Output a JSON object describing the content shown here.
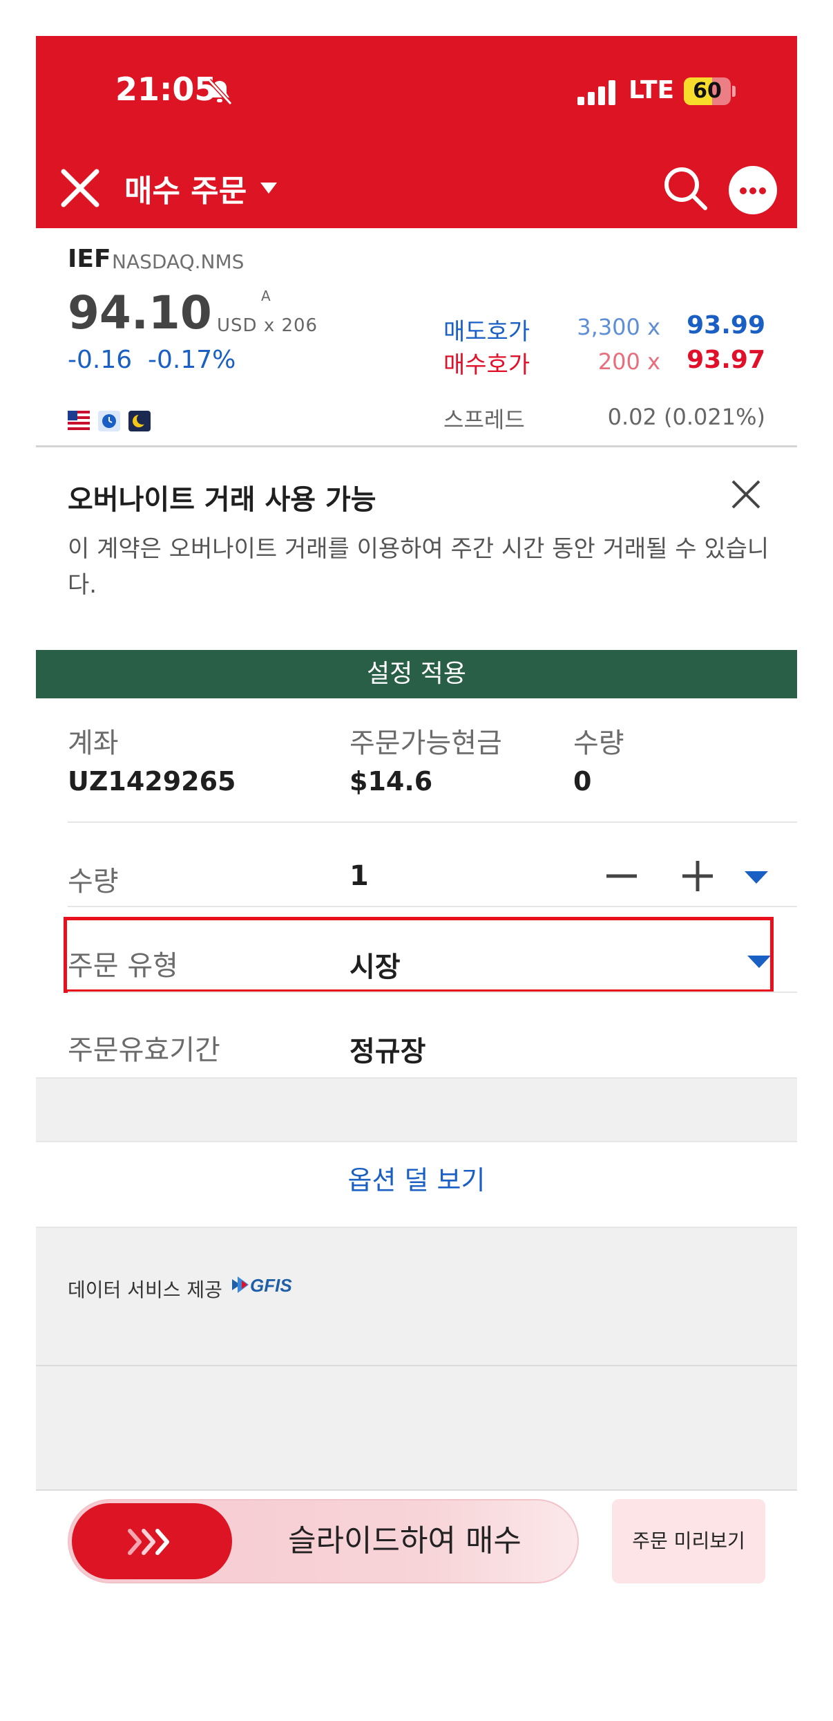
{
  "status_bar": {
    "time": "21:05",
    "network": "LTE",
    "battery": "60",
    "battery_level": 0.6
  },
  "header": {
    "title": "매수 주문",
    "close_icon": "close-icon",
    "search_icon": "search-icon",
    "more_icon": "more-icon"
  },
  "quote": {
    "symbol": "IEF",
    "exchange": "NASDAQ.NMS",
    "last_price": "94.10",
    "flag": "A",
    "currency": "USD x 206",
    "change": "-0.16  -0.17%",
    "ask_label": "매도호가",
    "ask_size": "3,300 x",
    "ask_price": "93.99",
    "bid_label": "매수호가",
    "bid_size": "200 x",
    "bid_price": "93.97",
    "spread_label": "스프레드",
    "spread_value": "0.02 (0.021%)"
  },
  "banner": {
    "title": "오버나이트 거래 사용 가능",
    "text": "이 계약은 오버나이트 거래를 이용하여 주간 시간 동안 거래될 수 있습니다."
  },
  "apply_settings": "설정 적용",
  "account": {
    "account_label": "계좌",
    "account_value": "UZ1429265",
    "cash_label": "주문가능현금",
    "cash_value": "$14.6",
    "qty_label": "수량",
    "qty_value": "0"
  },
  "order": {
    "quantity_label": "수량",
    "quantity_value": "1",
    "type_label": "주문 유형",
    "type_value": "시장",
    "tif_label": "주문유효기간",
    "tif_value": "정규장"
  },
  "less_options": "옵션 덜 보기",
  "data_provider": "데이터 서비스 제공",
  "provider_logo": "GFIS",
  "actions": {
    "slide_label": "슬라이드하여 매수",
    "preview_label": "주문 미리보기"
  },
  "colors": {
    "brand_red": "#dc1423",
    "apply_green": "#295f46",
    "ask_blue": "#1a5fc3",
    "bid_red": "#e0102a"
  }
}
